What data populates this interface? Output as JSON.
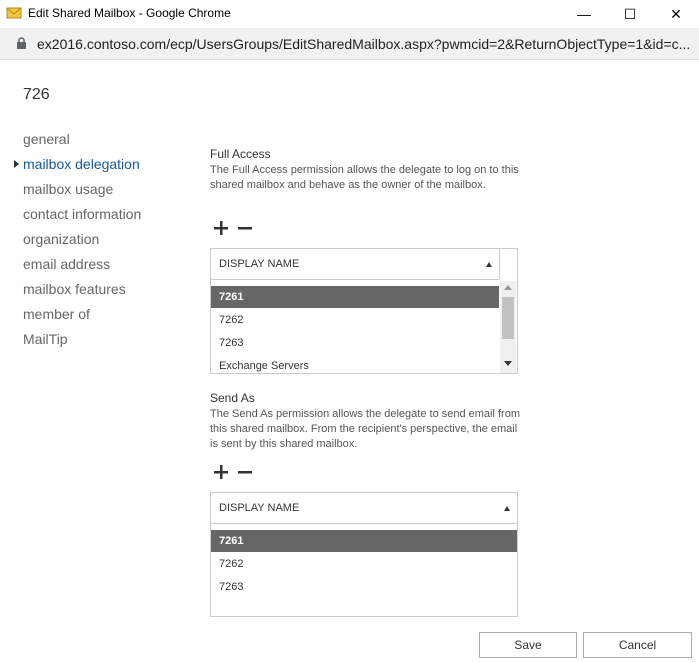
{
  "window": {
    "title": "Edit Shared Mailbox - Google Chrome",
    "minimize_glyph": "—",
    "maximize_glyph": "☐",
    "close_glyph": "✕"
  },
  "address_bar": {
    "url": "ex2016.contoso.com/ecp/UsersGroups/EditSharedMailbox.aspx?pwmcid=2&ReturnObjectType=1&id=c..."
  },
  "page": {
    "title": "726"
  },
  "nav": {
    "items": [
      {
        "label": "general"
      },
      {
        "label": "mailbox delegation"
      },
      {
        "label": "mailbox usage"
      },
      {
        "label": "contact information"
      },
      {
        "label": "organization"
      },
      {
        "label": "email address"
      },
      {
        "label": "mailbox features"
      },
      {
        "label": "member of"
      },
      {
        "label": "MailTip"
      }
    ],
    "active_index": 1
  },
  "full_access": {
    "title": "Full Access",
    "description": "The Full Access permission allows the delegate to log on to this shared mailbox and behave as the owner of the mailbox.",
    "column_header": "DISPLAY NAME",
    "rows": [
      "7261",
      "7262",
      "7263",
      "Exchange Servers"
    ],
    "selected_index": 0
  },
  "send_as": {
    "title": "Send As",
    "description": "The Send As permission allows the delegate to send email from this shared mailbox. From the recipient's perspective, the email is sent by this shared mailbox.",
    "column_header": "DISPLAY NAME",
    "rows": [
      "7261",
      "7262",
      "7263"
    ],
    "selected_index": 0
  },
  "footer": {
    "save_label": "Save",
    "cancel_label": "Cancel"
  },
  "colors": {
    "accent": "#1a5a96",
    "selected_row": "#666666"
  },
  "icons": [
    "mailbox-app-icon",
    "lock-icon",
    "add-icon",
    "remove-icon",
    "sort-ascending-icon",
    "nav-arrow-icon"
  ]
}
